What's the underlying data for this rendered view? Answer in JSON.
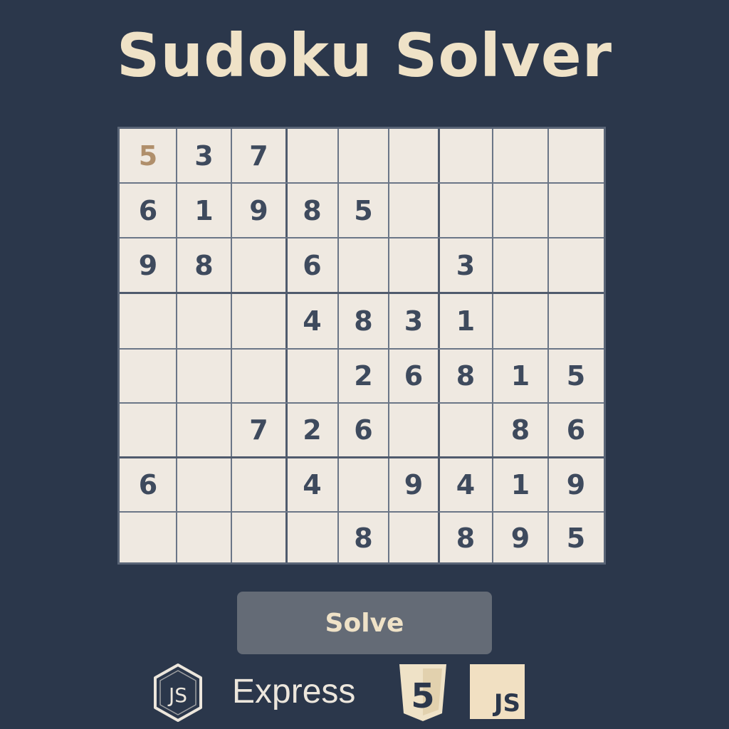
{
  "app": {
    "title": "Sudoku Solver"
  },
  "colors": {
    "background": "#2b374b",
    "title": "#efe2c7",
    "board_fill": "#efe9e1",
    "digit": "#3e4a5d",
    "highlight_digit": "#b08f6b",
    "button_fill": "#646b76"
  },
  "grid": {
    "rows": [
      [
        "5",
        "3",
        "7",
        "",
        "",
        "",
        "",
        "",
        ""
      ],
      [
        "6",
        "1",
        "9",
        "8",
        "5",
        "",
        "",
        "",
        ""
      ],
      [
        "9",
        "8",
        "",
        "6",
        "",
        "",
        "3",
        "",
        ""
      ],
      [
        "",
        "",
        "",
        "4",
        "8",
        "3",
        "1",
        "",
        ""
      ],
      [
        "",
        "",
        "",
        "",
        "2",
        "6",
        "8",
        "1",
        "5"
      ],
      [
        "",
        "",
        "7",
        "2",
        "6",
        "",
        "",
        "8",
        "6"
      ],
      [
        "6",
        "",
        "",
        "4",
        "",
        "9",
        "4",
        "1",
        "9"
      ],
      [
        "",
        "",
        "",
        "",
        "8",
        "",
        "8",
        "9",
        "5"
      ]
    ],
    "highlighted_cell": {
      "row": 0,
      "col": 0
    }
  },
  "controls": {
    "solve_label": "Solve"
  },
  "tech_stack": {
    "node_icon": "nodejs-hexagon-icon",
    "node_text": "JS",
    "express_label": "Express",
    "html5_icon": "html5-shield-icon",
    "html5_text": "5",
    "javascript_icon": "javascript-square-icon",
    "javascript_text": "JS"
  }
}
